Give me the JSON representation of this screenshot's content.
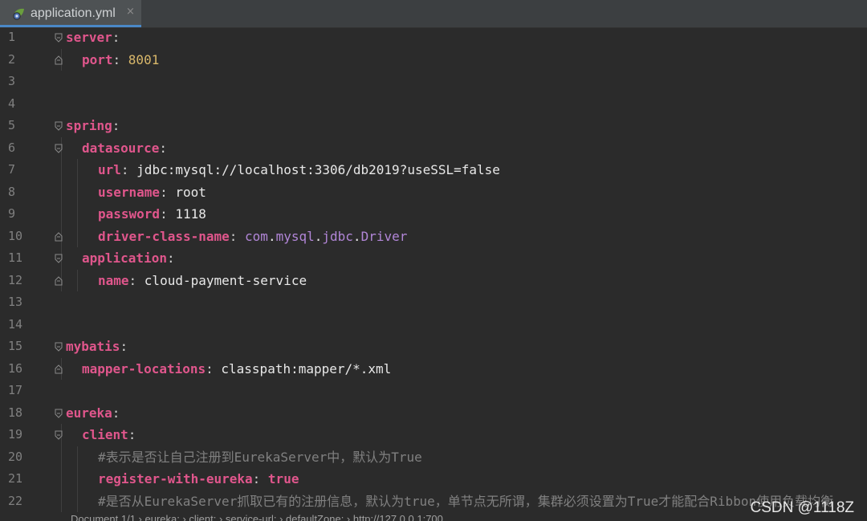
{
  "tab": {
    "title": "application.yml",
    "close_label": "×"
  },
  "colors": {
    "key": "#e0568c",
    "number": "#d8b76a",
    "comment": "#808080",
    "class": "#b286d8",
    "tab_accent": "#4a88c7"
  },
  "lines": [
    {
      "num": "1",
      "fold": "open",
      "indent": 0,
      "tokens": [
        [
          "k",
          "server"
        ],
        [
          "p",
          ":"
        ]
      ]
    },
    {
      "num": "2",
      "fold": "end",
      "indent": 1,
      "tokens": [
        [
          "k",
          "port"
        ],
        [
          "p",
          ": "
        ],
        [
          "n",
          "8001"
        ]
      ]
    },
    {
      "num": "3",
      "fold": "",
      "indent": 0,
      "tokens": []
    },
    {
      "num": "4",
      "fold": "",
      "indent": 0,
      "tokens": []
    },
    {
      "num": "5",
      "fold": "open",
      "indent": 0,
      "tokens": [
        [
          "k",
          "spring"
        ],
        [
          "p",
          ":"
        ]
      ]
    },
    {
      "num": "6",
      "fold": "open",
      "indent": 1,
      "tokens": [
        [
          "k",
          "datasource"
        ],
        [
          "p",
          ":"
        ]
      ]
    },
    {
      "num": "7",
      "fold": "",
      "indent": 2,
      "tokens": [
        [
          "k",
          "url"
        ],
        [
          "p",
          ": "
        ],
        [
          "v",
          "jdbc:mysql://localhost:3306/db2019?useSSL=false"
        ]
      ]
    },
    {
      "num": "8",
      "fold": "",
      "indent": 2,
      "tokens": [
        [
          "k",
          "username"
        ],
        [
          "p",
          ": "
        ],
        [
          "v",
          "root"
        ]
      ]
    },
    {
      "num": "9",
      "fold": "",
      "indent": 2,
      "tokens": [
        [
          "k",
          "password"
        ],
        [
          "p",
          ": "
        ],
        [
          "v",
          "1118"
        ]
      ]
    },
    {
      "num": "10",
      "fold": "end",
      "indent": 2,
      "tokens": [
        [
          "k",
          "driver-class-name"
        ],
        [
          "p",
          ": "
        ],
        [
          "cls",
          "com"
        ],
        [
          "v",
          "."
        ],
        [
          "cls",
          "mysql"
        ],
        [
          "v",
          "."
        ],
        [
          "cls",
          "jdbc"
        ],
        [
          "v",
          "."
        ],
        [
          "cls",
          "Driver"
        ]
      ]
    },
    {
      "num": "11",
      "fold": "open",
      "indent": 1,
      "tokens": [
        [
          "k",
          "application"
        ],
        [
          "p",
          ":"
        ]
      ]
    },
    {
      "num": "12",
      "fold": "end",
      "indent": 2,
      "tokens": [
        [
          "k",
          "name"
        ],
        [
          "p",
          ": "
        ],
        [
          "v",
          "cloud-payment-service"
        ]
      ]
    },
    {
      "num": "13",
      "fold": "",
      "indent": 0,
      "tokens": []
    },
    {
      "num": "14",
      "fold": "",
      "indent": 0,
      "tokens": []
    },
    {
      "num": "15",
      "fold": "open",
      "indent": 0,
      "tokens": [
        [
          "k",
          "mybatis"
        ],
        [
          "p",
          ":"
        ]
      ]
    },
    {
      "num": "16",
      "fold": "end",
      "indent": 1,
      "tokens": [
        [
          "k",
          "mapper-locations"
        ],
        [
          "p",
          ": "
        ],
        [
          "v",
          "classpath:mapper/*.xml"
        ]
      ]
    },
    {
      "num": "17",
      "fold": "",
      "indent": 0,
      "tokens": []
    },
    {
      "num": "18",
      "fold": "open",
      "indent": 0,
      "tokens": [
        [
          "k",
          "eureka"
        ],
        [
          "p",
          ":"
        ]
      ]
    },
    {
      "num": "19",
      "fold": "open",
      "indent": 1,
      "tokens": [
        [
          "k",
          "client"
        ],
        [
          "p",
          ":"
        ]
      ]
    },
    {
      "num": "20",
      "fold": "",
      "indent": 2,
      "tokens": [
        [
          "c",
          "#表示是否让自己注册到EurekaServer中，默认为True"
        ]
      ]
    },
    {
      "num": "21",
      "fold": "",
      "indent": 2,
      "tokens": [
        [
          "k",
          "register-with-eureka"
        ],
        [
          "p",
          ": "
        ],
        [
          "b",
          "true"
        ]
      ]
    },
    {
      "num": "22",
      "fold": "",
      "indent": 2,
      "tokens": [
        [
          "c",
          "#是否从EurekaServer抓取已有的注册信息，默认为true，单节点无所谓，集群必须设置为True才能配合Ribbon使用负载均衡"
        ]
      ]
    }
  ],
  "status_text": "Document 1/1  ›  eureka:  ›  client:  ›  service-url:  ›  defaultZone:  ›  http://127.0.0.1:700",
  "watermark": "CSDN @1118Z"
}
